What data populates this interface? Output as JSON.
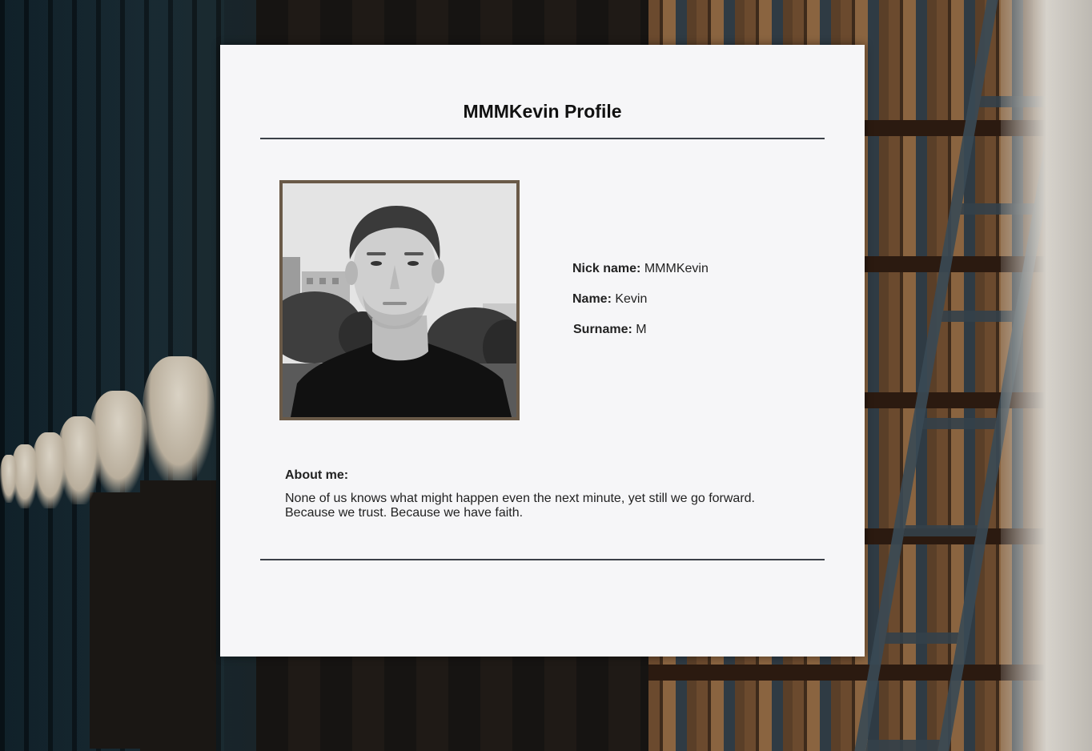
{
  "profile": {
    "title": "MMMKevin Profile",
    "photo_alt": "profile-photo",
    "details": [
      {
        "label": "Nick name:",
        "value": "MMMKevin"
      },
      {
        "label": "Name:",
        "value": "Kevin"
      },
      {
        "label": "Surname:",
        "value": "M"
      }
    ],
    "about": {
      "heading": "About me:",
      "text": "None of us knows what might happen even the next minute, yet still we go forward. Because we trust. Because we have faith."
    }
  },
  "colors": {
    "card_background": "#f6f6f8",
    "frame_border": "#6a5a48",
    "divider": "#3b4048"
  }
}
